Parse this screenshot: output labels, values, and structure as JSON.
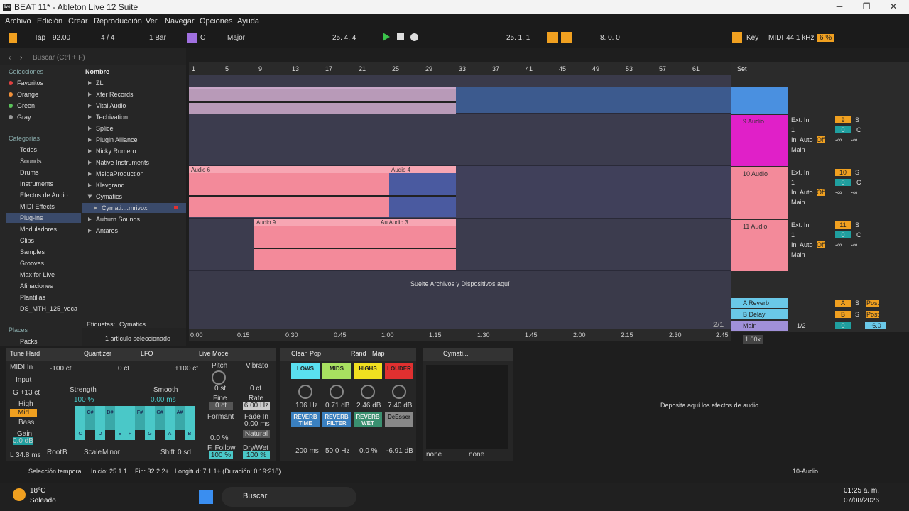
{
  "window": {
    "title": "BEAT 11* - Ableton Live 12 Suite",
    "logo_text": "live"
  },
  "menu": [
    "Archivo",
    "Edición",
    "Crear",
    "Reproducción",
    "Ver",
    "Navegar",
    "Opciones",
    "Ayuda"
  ],
  "control": {
    "tap": "Tap",
    "tempo": "92.00",
    "sig": "4 / 4",
    "quant": "1 Bar",
    "key_root": "C",
    "scale": "Major",
    "position": "25.   4.   4",
    "loop_start": "25.   1.   1",
    "loop_len": "8.   0.   0",
    "key_label": "Key",
    "midi_label": "MIDI",
    "sample_rate": "44.1 kHz",
    "cpu": "6 %"
  },
  "browser": {
    "search_placeholder": "Buscar (Ctrl + F)",
    "collections_header": "Colecciones",
    "collections": [
      {
        "label": "Favoritos",
        "color": "#e04040"
      },
      {
        "label": "Orange",
        "color": "#f0903a"
      },
      {
        "label": "Green",
        "color": "#5ac15a"
      },
      {
        "label": "Gray",
        "color": "#999999"
      }
    ],
    "categories_header": "Categorías",
    "categories": [
      "Todos",
      "Sounds",
      "Drums",
      "Instruments",
      "Efectos de Audio",
      "MIDI Effects",
      "Plug-ins",
      "Moduladores",
      "Clips",
      "Samples",
      "Grooves",
      "Max for Live",
      "Afinaciones",
      "Plantillas",
      "DS_MTH_125_voca"
    ],
    "places_header": "Places",
    "places": [
      "Packs"
    ],
    "column_header": "Nombre",
    "items": [
      "ZL",
      "Xfer Records",
      "Vital Audio",
      "Techivation",
      "Splice",
      "Plugin Alliance",
      "Nicky Romero",
      "Native Instruments",
      "MeldaProduction",
      "Klevgrand",
      "Cymatics",
      "Cymati....mrivox",
      "Auburn Sounds",
      "Antares"
    ],
    "tags_label": "Etiquetas:",
    "tags_value": "Cymatics",
    "selected": "1 artículo seleccionado"
  },
  "ruler": [
    "1",
    "5",
    "9",
    "13",
    "17",
    "21",
    "25",
    "29",
    "33",
    "37",
    "41",
    "45",
    "49",
    "53",
    "57",
    "61"
  ],
  "time_ruler": [
    "0:00",
    "0:15",
    "0:30",
    "0:45",
    "1:00",
    "1:15",
    "1:30",
    "1:45",
    "2:00",
    "2:15",
    "2:30",
    "2:45"
  ],
  "clips": {
    "audio6": "Audio 6",
    "audio4": "Audio 4",
    "audio9": "Audio 9",
    "audio3": "Au  Audio 3",
    "drop_hint": "Suelte Archivos y Dispositivos aquí"
  },
  "tracks": [
    {
      "name": "9 Audio",
      "num": "9",
      "input": "Ext. In",
      "ch": "1",
      "color": "#e020c8",
      "sel": "C"
    },
    {
      "name": "10 Audio",
      "num": "10",
      "input": "Ext. In",
      "ch": "1",
      "color": "#f38a9a",
      "sel": "C"
    },
    {
      "name": "11 Audio",
      "num": "11",
      "input": "Ext. In",
      "ch": "1",
      "color": "#f38a9a",
      "sel": "C"
    }
  ],
  "returns": [
    {
      "name": "A Reverb",
      "letter": "A"
    },
    {
      "name": "B Delay",
      "letter": "B"
    }
  ],
  "main": {
    "name": "Main",
    "routing": "1/2",
    "vol": "0",
    "pan": "-6.0",
    "zoom": "1.00x",
    "set": "Set",
    "page": "2/1"
  },
  "mixer_labels": {
    "in": "In",
    "auto": "Auto",
    "off": "Off",
    "main": "Main",
    "s": "S",
    "post": "Post",
    "zero": "0",
    "minf": "-∞"
  },
  "devices": {
    "tune": {
      "title": "Tune Hard",
      "quantizer": "Quantizer",
      "lfo": "LFO",
      "live_mode": "Live Mode",
      "midi_in": "MIDI In",
      "input": "Input",
      "high": "High",
      "mid": "Mid",
      "bass": "Bass",
      "gain": "Gain",
      "gain_val": "0.0 dB",
      "latency": "L 34.8 ms",
      "g13": "G +13 ct",
      "c_min": "-100 ct",
      "c_zero": "0 ct",
      "c_max": "+100 ct",
      "strength": "Strength",
      "strength_val": "100 %",
      "smooth": "Smooth",
      "smooth_val": "0.00 ms",
      "root": "Root",
      "root_val": "B",
      "scale": "Scale",
      "scale_val": "Minor",
      "shift": "Shift",
      "shift_val": "0 sd",
      "pitch": "Pitch",
      "pitch_val": "0 st",
      "fine": "Fine",
      "fine_val": "0 ct",
      "formant": "Formant",
      "formant_val": "0.0 %",
      "follow": "F. Follow",
      "follow_val": "100 %",
      "vibrato": "Vibrato",
      "vib_val": "0 ct",
      "rate": "Rate",
      "rate_val": "6.00 Hz",
      "fade": "Fade In",
      "fade_val": "0.00 ms",
      "natural": "Natural",
      "drywet": "Dry/Wet",
      "drywet_val": "100 %",
      "keys": [
        "C",
        "C#",
        "D",
        "D#",
        "E",
        "F",
        "F#",
        "G",
        "G#",
        "A",
        "A#",
        "B"
      ]
    },
    "clean": {
      "title": "Clean Pop",
      "rand": "Rand",
      "map": "Map",
      "lows": "LOWS",
      "mids": "MIDS",
      "highs": "HIGHS",
      "louder": "LOUDER",
      "v1": "106 Hz",
      "v2": "0.71 dB",
      "v3": "2.46 dB",
      "v4": "7.40 dB",
      "rt": "REVERB TIME",
      "rf": "REVERB FILTER",
      "rw": "REVERB WET",
      "de": "DeEsser",
      "v5": "200 ms",
      "v6": "50.0 Hz",
      "v7": "0.0 %",
      "v8": "-6.91 dB"
    },
    "cymat": {
      "title": "Cymati...",
      "none1": "none",
      "none2": "none"
    },
    "drop_fx": "Deposita aquí los efectos de audio"
  },
  "status": {
    "sel": "Selección temporal",
    "start": "Inicio: 25.1.1",
    "end": "Fin: 32.2.2+",
    "len": "Longitud: 7.1.1+ (Duración: 0:19:218)",
    "track": "10-Audio"
  },
  "taskbar": {
    "temp": "18°C",
    "weather": "Soleado",
    "search": "Buscar",
    "time": "01:25 a. m.",
    "date": "07/08/2026"
  }
}
